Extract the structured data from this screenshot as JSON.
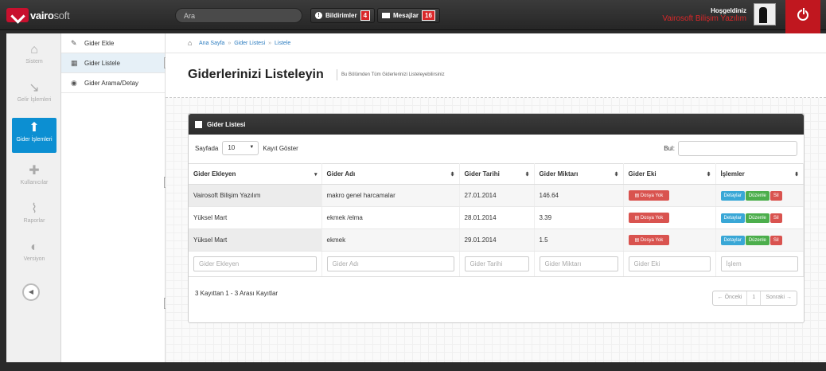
{
  "header": {
    "logo_main": "vairo",
    "logo_soft": "soft",
    "search_placeholder": "Ara",
    "notifications_label": "Bildirimler",
    "notifications_count": "4",
    "messages_label": "Mesajlar",
    "messages_count": "16",
    "welcome": "Hoşgeldiniz",
    "user_name": "Vairosoft Bilişim Yazılım"
  },
  "iconbar": [
    {
      "label": "Sistem",
      "icon": "home-icon"
    },
    {
      "label": "Gelir İşlemleri",
      "icon": "arrow-down-icon"
    },
    {
      "label": "Gider İşlemleri",
      "icon": "arrow-up-icon"
    },
    {
      "label": "Kullanıcılar",
      "icon": "user-add-icon"
    },
    {
      "label": "Raporlar",
      "icon": "paperclip-icon"
    },
    {
      "label": "Versiyon",
      "icon": "toggle-icon"
    }
  ],
  "submenu": [
    {
      "label": "Gider Ekle"
    },
    {
      "label": "Gider Listele"
    },
    {
      "label": "Gider Arama/Detay"
    }
  ],
  "breadcrumb": [
    "Ana Sayfa",
    "Gider Listesi",
    "Listele"
  ],
  "page": {
    "title": "Giderlerinizi Listeleyin",
    "subtitle": "Bu Bölümden Tüm Giderlerinizi Listeleyebilirsiniz"
  },
  "widget": {
    "title": "Gider Listesi",
    "page_size_prefix": "Sayfada",
    "page_size_value": "10",
    "page_size_suffix": "Kayıt Göster",
    "find_label": "Bul:"
  },
  "table": {
    "columns": [
      "Gider Ekleyen",
      "Gider Adı",
      "Gider Tarihi",
      "Gider Miktarı",
      "Gider Eki",
      "İşlemler"
    ],
    "rows": [
      {
        "adder": "Vairosoft Bilişim Yazılım",
        "name": "makro genel harcamalar",
        "date": "27.01.2014",
        "amount": "146.64",
        "attachment": "Dosya Yok"
      },
      {
        "adder": "Yüksel Mart",
        "name": "ekmek /elma",
        "date": "28.01.2014",
        "amount": "3.39",
        "attachment": "Dosya Yok"
      },
      {
        "adder": "Yüksel Mart",
        "name": "ekmek",
        "date": "29.01.2014",
        "amount": "1.5",
        "attachment": "Dosya Yok"
      }
    ],
    "action_labels": {
      "detail": "Detaylar",
      "edit": "Düzenle",
      "delete": "Sil"
    },
    "filters": [
      "Gider Ekleyen",
      "Gider Adı",
      "Gider Tarihi",
      "Gider Miktarı",
      "Gider Eki",
      "İşlem"
    ]
  },
  "footer": {
    "info": "3 Kayıttan 1 - 3 Arası Kayıtlar",
    "prev": "← Önceki",
    "page": "1",
    "next": "Sonraki →"
  }
}
